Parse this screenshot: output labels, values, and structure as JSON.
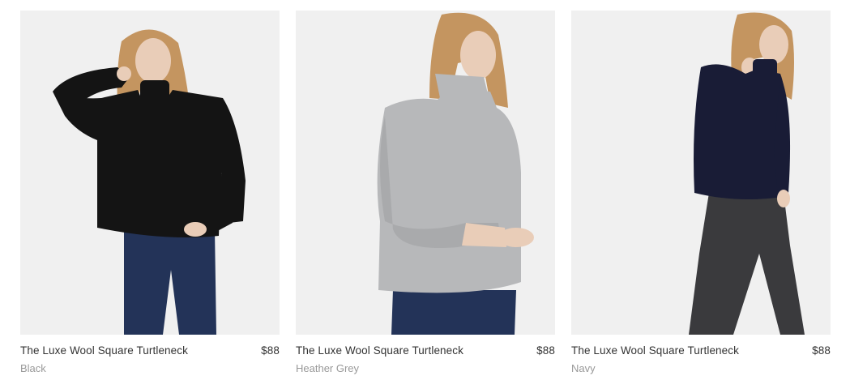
{
  "products": [
    {
      "name": "The Luxe Wool Square Turtleneck",
      "price": "$88",
      "color": "Black"
    },
    {
      "name": "The Luxe Wool Square Turtleneck",
      "price": "$88",
      "color": "Heather Grey"
    },
    {
      "name": "The Luxe Wool Square Turtleneck",
      "price": "$88",
      "color": "Navy"
    }
  ],
  "palette": {
    "photo_bg": "#f0f0f0",
    "sweater_black": "#141414",
    "sweater_grey": "#b7b8ba",
    "sweater_navy": "#191c36",
    "jeans": "#233358",
    "trousers": "#3a3a3d",
    "hair": "#c49560",
    "skin": "#e9cdb8"
  }
}
